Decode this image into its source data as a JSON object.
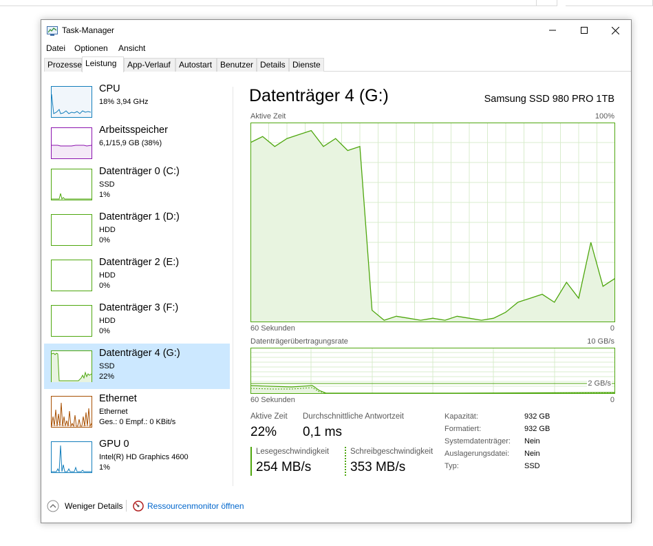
{
  "window": {
    "title": "Task-Manager"
  },
  "menu": [
    "Datei",
    "Optionen",
    "Ansicht"
  ],
  "tabs": [
    "Prozesse",
    "Leistung",
    "App-Verlauf",
    "Autostart",
    "Benutzer",
    "Details",
    "Dienste"
  ],
  "active_tab": "Leistung",
  "sidebar": [
    {
      "name": "CPU",
      "line1": "18% 3,94 GHz",
      "line2": "",
      "color": "#117dbb"
    },
    {
      "name": "Arbeitsspeicher",
      "line1": "6,1/15,9 GB (38%)",
      "line2": "",
      "color": "#8b12ae"
    },
    {
      "name": "Datenträger 0 (C:)",
      "line1": "SSD",
      "line2": "1%",
      "color": "#4da60c"
    },
    {
      "name": "Datenträger 1 (D:)",
      "line1": "HDD",
      "line2": "0%",
      "color": "#4da60c"
    },
    {
      "name": "Datenträger 2 (E:)",
      "line1": "HDD",
      "line2": "0%",
      "color": "#4da60c"
    },
    {
      "name": "Datenträger 3 (F:)",
      "line1": "HDD",
      "line2": "0%",
      "color": "#4da60c"
    },
    {
      "name": "Datenträger 4 (G:)",
      "line1": "SSD",
      "line2": "22%",
      "color": "#4da60c"
    },
    {
      "name": "Ethernet",
      "line1": "Ethernet",
      "line2": "Ges.: 0 Empf.: 0 KBit/s",
      "color": "#a74f01"
    },
    {
      "name": "GPU 0",
      "line1": "Intel(R) HD Graphics 4600",
      "line2": "1%",
      "color": "#117dbb"
    }
  ],
  "selected_index": 6,
  "main": {
    "title": "Datenträger 4 (G:)",
    "model": "Samsung SSD 980 PRO 1TB",
    "chart1_label": "Aktive Zeit",
    "chart1_max": "100%",
    "chart1_xleft": "60 Sekunden",
    "chart1_xright": "0",
    "chart2_label": "Datenträgerübertragungsrate",
    "chart2_max": "10 GB/s",
    "chart2_ref": "2 GB/s",
    "chart2_xleft": "60 Sekunden",
    "chart2_xright": "0",
    "active_time_label": "Aktive Zeit",
    "active_time_value": "22%",
    "avg_response_label": "Durchschnittliche Antwortzeit",
    "avg_response_value": "0,1 ms",
    "read_label": "Lesegeschwindigkeit",
    "read_value": "254 MB/s",
    "write_label": "Schreibgeschwindigkeit",
    "write_value": "353 MB/s"
  },
  "properties": [
    {
      "label": "Kapazität:",
      "value": "932 GB"
    },
    {
      "label": "Formatiert:",
      "value": "932 GB"
    },
    {
      "label": "Systemdatenträger:",
      "value": "Nein"
    },
    {
      "label": "Auslagerungsdatei:",
      "value": "Nein"
    },
    {
      "label": "Typ:",
      "value": "SSD"
    }
  ],
  "footer": {
    "fewer_details": "Weniger Details",
    "resource_monitor": "Ressourcenmonitor öffnen"
  },
  "colors": {
    "disk": "#4da60c",
    "disk_fill": "#e8f4e0",
    "grid": "#d8eccc",
    "selected_bg": "#cce8ff",
    "link": "#0066cc"
  },
  "chart_data": {
    "type": "area",
    "title": "Aktive Zeit",
    "x": [
      60,
      58,
      56,
      54,
      52,
      50,
      48,
      46,
      44,
      42,
      40,
      38,
      36,
      34,
      32,
      30,
      28,
      26,
      24,
      22,
      20,
      18,
      16,
      14,
      12,
      10,
      8,
      6,
      4,
      2,
      0
    ],
    "ylim": [
      0,
      100
    ],
    "series": [
      {
        "values": [
          90,
          93,
          88,
          92,
          94,
          96,
          88,
          92,
          86,
          88,
          6,
          1,
          3,
          2,
          1,
          2,
          1,
          3,
          2,
          1,
          2,
          5,
          10,
          12,
          14,
          10,
          20,
          12,
          40,
          18,
          22
        ]
      }
    ]
  }
}
